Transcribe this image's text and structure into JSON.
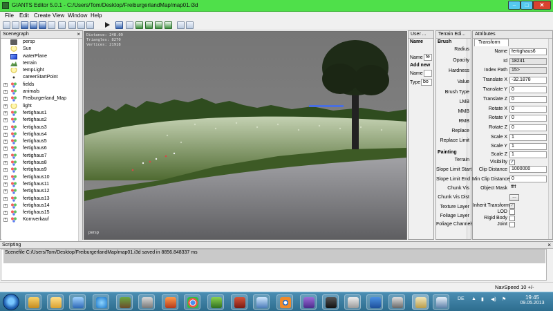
{
  "window": {
    "title": "GIANTS Editor 5.0.1 - C:/Users/Tom/Desktop/FreiburgerlandMap/map01.i3d",
    "titlebar_color": "#4fe04a",
    "min_glyph": "–",
    "max_glyph": "□",
    "close_glyph": "✕"
  },
  "menu": [
    "File",
    "Edit",
    "Create",
    "View",
    "Window",
    "Help"
  ],
  "scenegraph": {
    "title": "Scenegraph",
    "items": [
      {
        "label": "persp",
        "icon": "camera-icon",
        "expand": ""
      },
      {
        "label": "Sun",
        "icon": "light-icon",
        "expand": ""
      },
      {
        "label": "waterPlane",
        "icon": "mesh-icon",
        "expand": ""
      },
      {
        "label": "terrain",
        "icon": "terrain-icon",
        "expand": ""
      },
      {
        "label": "tempLight",
        "icon": "light-icon",
        "expand": ""
      },
      {
        "label": "careerStartPoint",
        "icon": "transform-icon",
        "expand": ""
      },
      {
        "label": "fields",
        "icon": "group-icon",
        "expand": "+"
      },
      {
        "label": "animals",
        "icon": "group-icon",
        "expand": "+"
      },
      {
        "label": "Freiburgerland_Map",
        "icon": "group-icon",
        "expand": "+"
      },
      {
        "label": "light",
        "icon": "light-icon",
        "expand": "+"
      },
      {
        "label": "fertighaus1",
        "icon": "group-icon",
        "expand": "+"
      },
      {
        "label": "fertighaus2",
        "icon": "group-icon",
        "expand": "+"
      },
      {
        "label": "fertighaus3",
        "icon": "group-icon",
        "expand": "+"
      },
      {
        "label": "fertighaus4",
        "icon": "group-icon",
        "expand": "+"
      },
      {
        "label": "fertighaus5",
        "icon": "group-icon",
        "expand": "+"
      },
      {
        "label": "fertighaus6",
        "icon": "group-icon",
        "expand": "+"
      },
      {
        "label": "fertighaus7",
        "icon": "group-icon",
        "expand": "+"
      },
      {
        "label": "fertighaus8",
        "icon": "group-icon",
        "expand": "+"
      },
      {
        "label": "fertighaus9",
        "icon": "group-icon",
        "expand": "+"
      },
      {
        "label": "fertighaus10",
        "icon": "group-icon",
        "expand": "+"
      },
      {
        "label": "fertighaus11",
        "icon": "group-icon",
        "expand": "+"
      },
      {
        "label": "fertighaus12",
        "icon": "group-icon",
        "expand": "+"
      },
      {
        "label": "fertighaus13",
        "icon": "group-icon",
        "expand": "+"
      },
      {
        "label": "fertighaus14",
        "icon": "group-icon",
        "expand": "+"
      },
      {
        "label": "fertighaus15",
        "icon": "group-icon",
        "expand": "+"
      },
      {
        "label": "Kornverkauf",
        "icon": "group-icon",
        "expand": "+"
      }
    ]
  },
  "viewport": {
    "stats": [
      "Distance: 248.09",
      "Triangles: 8270",
      "Vertices: 21918"
    ],
    "camera_label": "persp"
  },
  "user_attributes": {
    "title": "User ...",
    "name_header": "Name",
    "name_label": "Name",
    "name_value": "fe",
    "add_new": "Add new",
    "name_label2": "Name",
    "type_label": "Type",
    "type_value": "bo"
  },
  "terrain_editing": {
    "title": "Terrain Edi...",
    "section_brush": "Brush",
    "brush_fields": [
      "Radius",
      "Opacity",
      "Hardness",
      "Value",
      "Brush Type",
      "LMB",
      "MMB",
      "RMB",
      "Replace",
      "Replace Limit"
    ],
    "section_painting": "Painting",
    "painting_fields": [
      "Terrain",
      "Slope Limit Start",
      "Slope Limit End",
      "Chunk Vis",
      "Chunk Vis Dist",
      "Texture Layer",
      "Foliage Layer",
      "Foliage Channels"
    ]
  },
  "attributes": {
    "title": "Attributes",
    "tab": "Transform",
    "fields": [
      {
        "label": "Name",
        "value": "fertighaus6",
        "readonly": false
      },
      {
        "label": "Id",
        "value": "18241",
        "readonly": true
      },
      {
        "label": "Index Path",
        "value": "15>",
        "readonly": true
      },
      {
        "label": "Translate X",
        "value": "-32.1878",
        "readonly": false
      },
      {
        "label": "Translate Y",
        "value": "0",
        "readonly": false
      },
      {
        "label": "Translate Z",
        "value": "0",
        "readonly": false
      },
      {
        "label": "Rotate X",
        "value": "0",
        "readonly": false
      },
      {
        "label": "Rotate Y",
        "value": "0",
        "readonly": false
      },
      {
        "label": "Rotate Z",
        "value": "0",
        "readonly": false
      },
      {
        "label": "Scale X",
        "value": "1",
        "readonly": false
      },
      {
        "label": "Scale Y",
        "value": "1",
        "readonly": false
      },
      {
        "label": "Scale Z",
        "value": "1",
        "readonly": false
      }
    ],
    "visibility_label": "Visibility",
    "visibility_checked": "✓",
    "clip_distance_label": "Clip Distance",
    "clip_distance_value": "1000000",
    "min_clip_label": "Min Clip Distance",
    "min_clip_value": "0",
    "object_mask_label": "Object Mask",
    "object_mask_value": "ffff",
    "more_button": "...",
    "inherit_label": "Inherit Transform",
    "inherit_checked": "✓",
    "lod_label": "LOD",
    "rigid_label": "Rigid Body",
    "joint_label": "Joint"
  },
  "scripting": {
    "title": "Scripting",
    "output": "Scenefile C:/Users/Tom/Desktop/FreiburgerlandMap/map01.i3d saved in 8856.848337 ms"
  },
  "status": {
    "navspeed": "NavSpeed 10 +/-"
  },
  "taskbar": {
    "lang": "DE",
    "time": "19:45",
    "date": "09.05.2013"
  }
}
